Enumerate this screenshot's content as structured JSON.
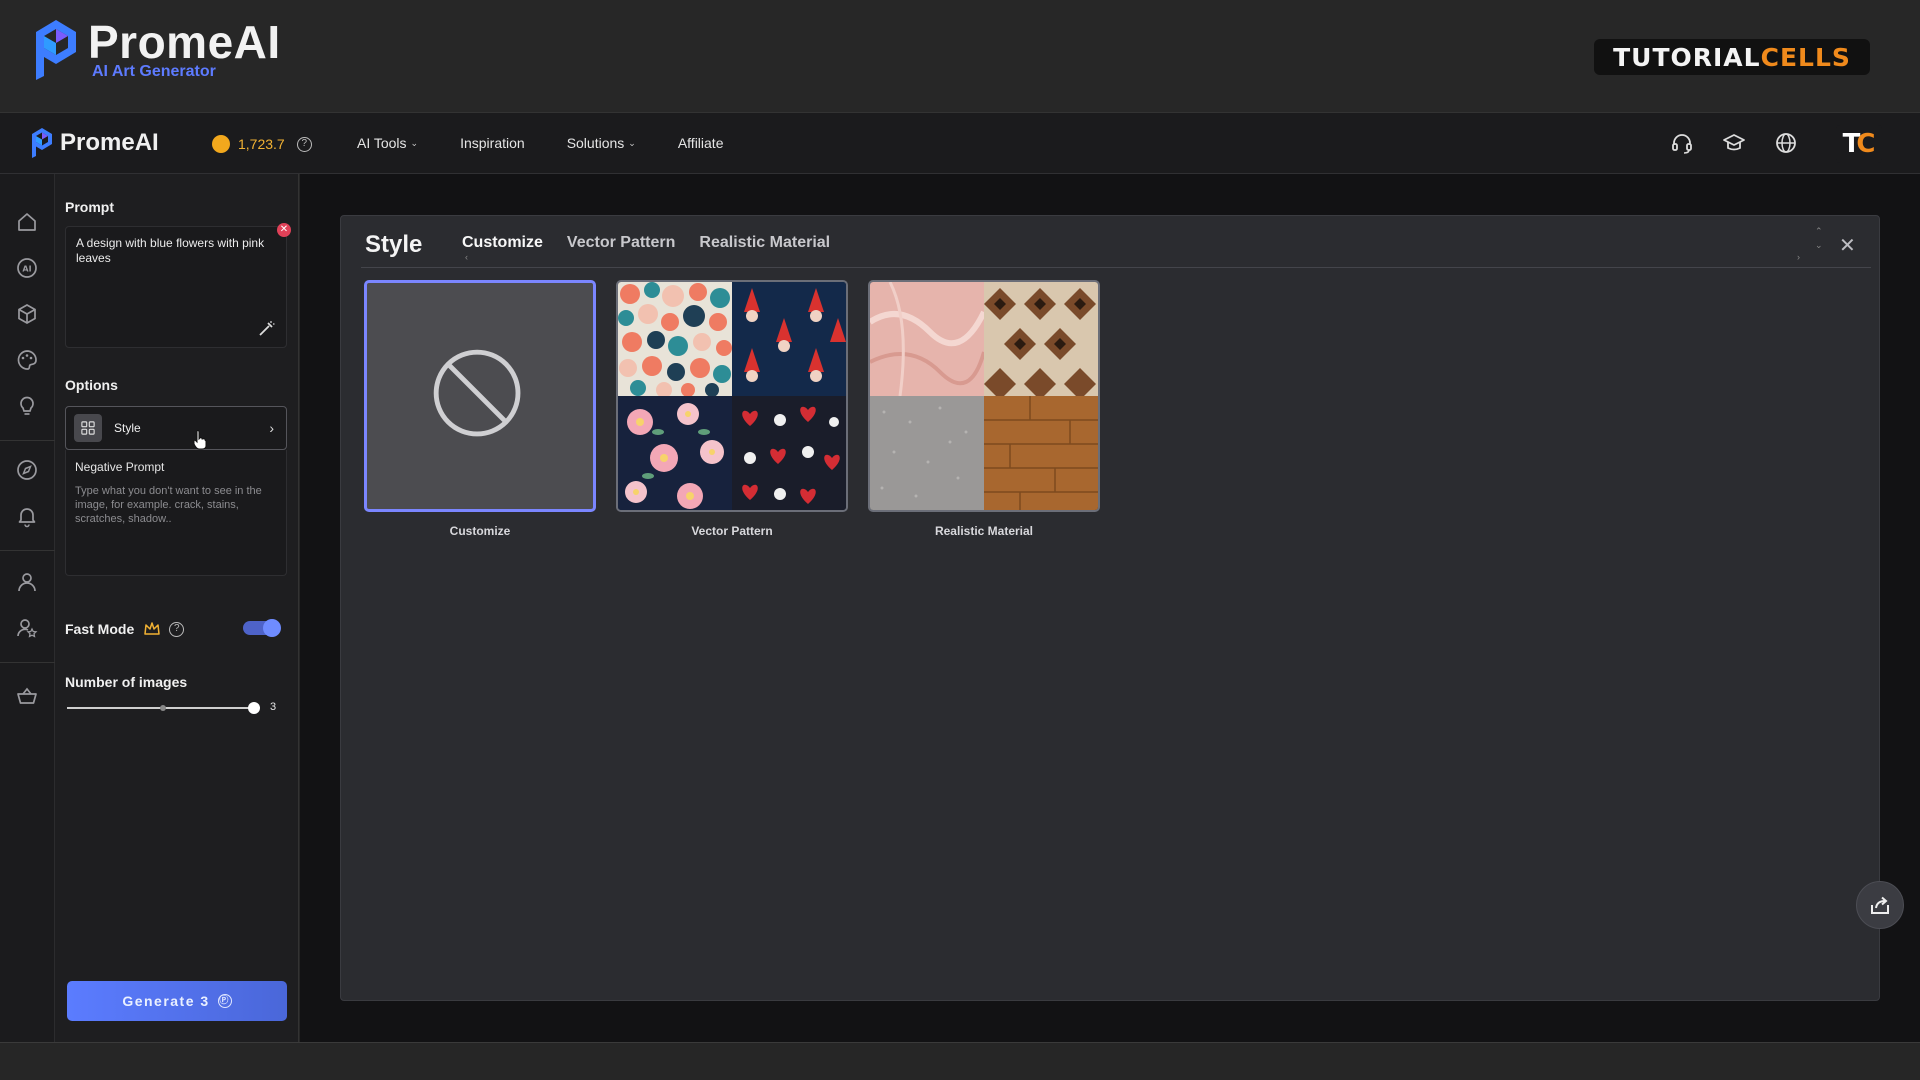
{
  "banner": {
    "brand_name": "PromeAI",
    "brand_tagline": "AI Art Generator",
    "badge_part1": "TUTORIAL",
    "badge_part2": "CELLS"
  },
  "header": {
    "app_name": "PromeAI",
    "credits": "1,723.7",
    "nav": [
      {
        "label": "AI Tools",
        "has_dropdown": true
      },
      {
        "label": "Inspiration",
        "has_dropdown": false
      },
      {
        "label": "Solutions",
        "has_dropdown": true
      },
      {
        "label": "Affiliate",
        "has_dropdown": false
      }
    ],
    "icons": [
      "headset-icon",
      "graduation-cap-icon",
      "globe-icon"
    ],
    "avatar_t": "T",
    "avatar_c": "C"
  },
  "rail_icons": [
    "home-icon",
    "ai-icon",
    "cube-icon",
    "palette-icon",
    "bulb-icon",
    "compass-icon",
    "bell-icon",
    "user-icon",
    "user-star-icon",
    "basket-icon"
  ],
  "panel": {
    "prompt_label": "Prompt",
    "prompt_value": "A design with blue flowers with pink leaves",
    "options_label": "Options",
    "style_label": "Style",
    "negative_title": "Negative Prompt",
    "negative_placeholder": "Type what you don't want to see in the image, for example. crack, stains, scratches, shadow..",
    "fast_mode_label": "Fast Mode",
    "fast_mode_on": true,
    "num_images_label": "Number of images",
    "num_images_value": "3",
    "num_images_fraction": 1.0,
    "generate_label": "Generate 3"
  },
  "modal": {
    "title": "Style",
    "tabs": [
      "Customize",
      "Vector Pattern",
      "Realistic Material"
    ],
    "active_tab": 0,
    "cards": [
      {
        "label": "Customize",
        "selected": true
      },
      {
        "label": "Vector Pattern",
        "selected": false
      },
      {
        "label": "Realistic Material",
        "selected": false
      }
    ]
  },
  "colors": {
    "accent": "#5b7cff",
    "brand_orange": "#f08a1c",
    "credit_gold": "#f2b233"
  }
}
